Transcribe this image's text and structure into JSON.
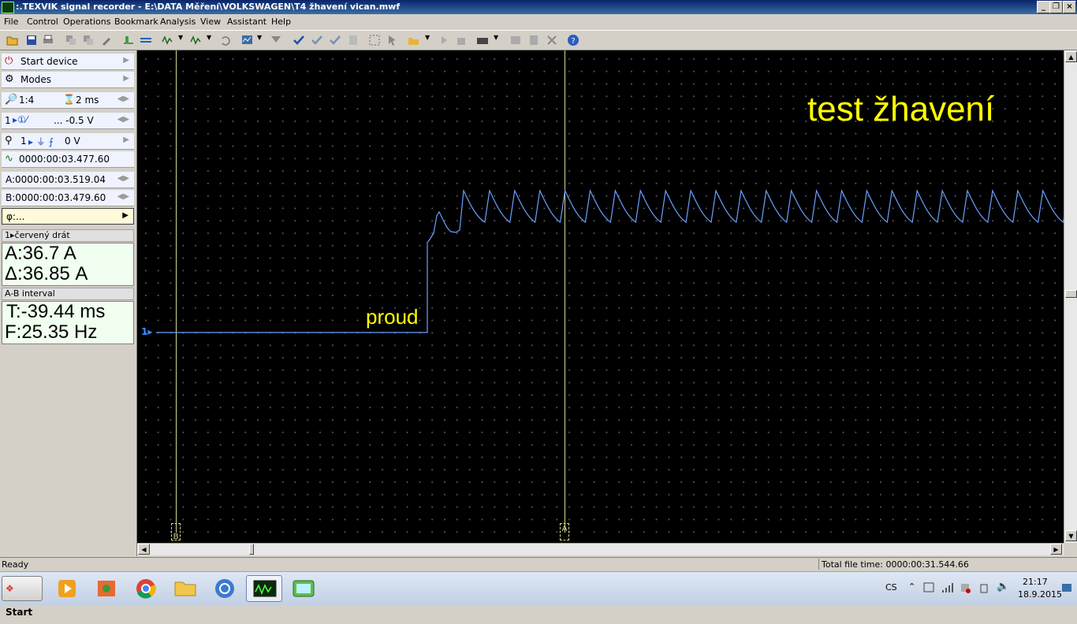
{
  "window": {
    "title": ":.TEXVIK  signal recorder - E:\\DATA Měření\\VOLKSWAGEN\\T4 žhavení vican.mwf"
  },
  "menu": [
    "File",
    "Control",
    "Operations",
    "Bookmark",
    "Analysis",
    "View",
    "Assistant",
    "Help"
  ],
  "panel": {
    "start_device": "Start device",
    "modes": "Modes",
    "zoom": "1:4",
    "timebase": "2 ms",
    "channel_line": "1",
    "channel_offset": "... -0.5 V",
    "trigger_line": "1",
    "trigger_level": "0 V",
    "trigger_time": "0000:00:03.477.60",
    "cursor_a": "A:0000:00:03.519.04",
    "cursor_b": "B:0000:00:03.479.60",
    "phi": "φ:...",
    "channel_name": "1▸červený drát",
    "channel_a": "A:36.7 A",
    "channel_delta": "Δ:36.85 A",
    "interval_head": "A-B interval",
    "interval_t": "T:-39.44 ms",
    "interval_f": "F:25.35 Hz"
  },
  "scope": {
    "title": "test žhavení",
    "signal_label": "proud",
    "channel_marker": "1▸",
    "cursor_b_label": "B",
    "cursor_a_label": "A"
  },
  "status": {
    "left": "Ready",
    "right": "Total file time: 0000:00:31.544.66"
  },
  "taskbar": {
    "start": "Start",
    "lang": "CS",
    "time": "21:17",
    "date": "18.9.2015"
  },
  "colors": {
    "signal": "#6aa0ff",
    "label": "#ffff00",
    "cursor": "#d8d890",
    "grid_dot": "#5a5a5a"
  }
}
